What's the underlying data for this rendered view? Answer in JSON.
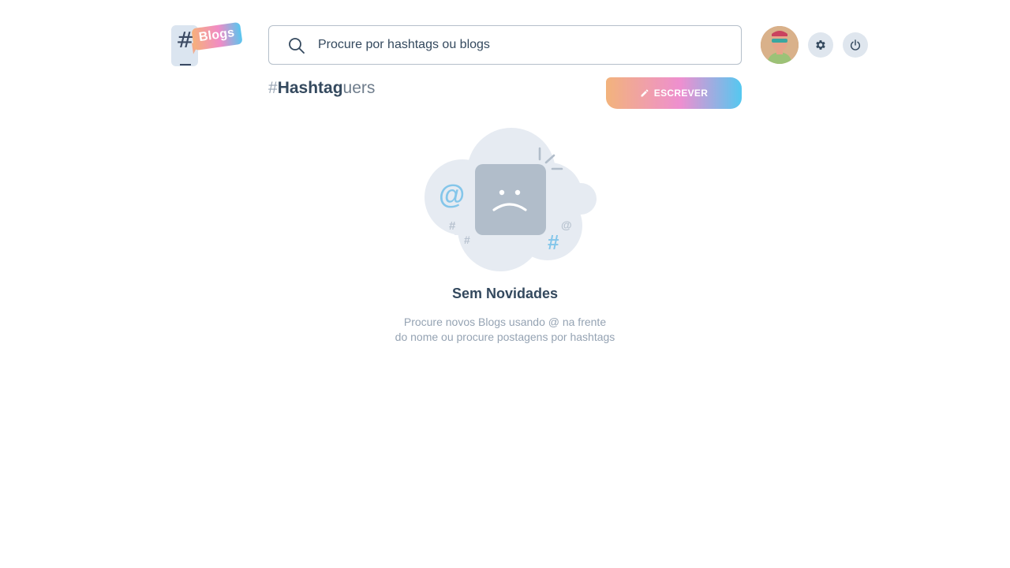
{
  "logo": {
    "hash": "#",
    "text": "Blogs"
  },
  "search": {
    "placeholder": "Procure por hashtags ou blogs",
    "icon": "search-icon"
  },
  "header": {
    "avatar_icon": "user-avatar",
    "settings_icon": "gear-icon",
    "logout_icon": "power-icon"
  },
  "page": {
    "title_hash": "#",
    "title_bold": "Hashtag",
    "title_light": "uers"
  },
  "write_button": {
    "label": "ESCREVER",
    "icon": "pencil-icon"
  },
  "empty_state": {
    "title": "Sem Novidades",
    "line1": "Procure novos Blogs usando @ na frente",
    "line2": "do nome ou procure postagens por hashtags"
  },
  "colors": {
    "text": "#34495e",
    "muted": "#95a3b3",
    "gradient_start": "#f2b37c",
    "gradient_mid": "#ee8fd0",
    "gradient_end": "#54c8f0"
  }
}
